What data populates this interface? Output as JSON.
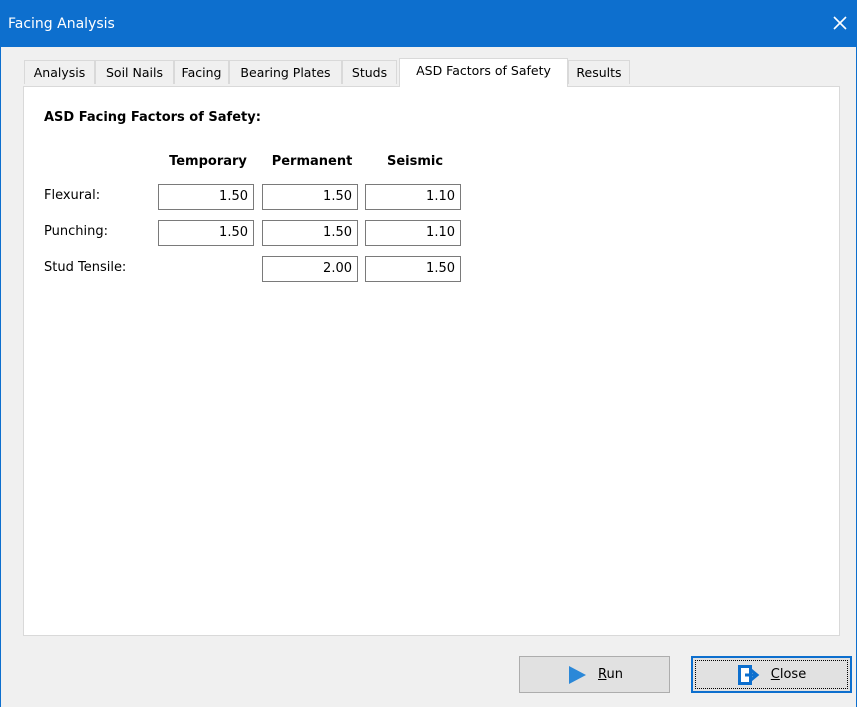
{
  "window": {
    "title": "Facing Analysis"
  },
  "tabs": [
    {
      "label": "Analysis"
    },
    {
      "label": "Soil Nails"
    },
    {
      "label": "Facing"
    },
    {
      "label": "Bearing Plates"
    },
    {
      "label": "Studs"
    },
    {
      "label": "ASD Factors of Safety",
      "active": true
    },
    {
      "label": "Results"
    }
  ],
  "section": {
    "title": "ASD Facing Factors of Safety:",
    "columns": [
      "Temporary",
      "Permanent",
      "Seismic"
    ],
    "rows": [
      {
        "label": "Flexural:",
        "temporary": "1.50",
        "permanent": "1.50",
        "seismic": "1.10"
      },
      {
        "label": "Punching:",
        "temporary": "1.50",
        "permanent": "1.50",
        "seismic": "1.10"
      },
      {
        "label": "Stud Tensile:",
        "temporary": "",
        "permanent": "2.00",
        "seismic": "1.50"
      }
    ]
  },
  "buttons": {
    "run": {
      "mnemonic": "R",
      "rest": "un",
      "icon": "play-icon",
      "color": "#2b88d8"
    },
    "close": {
      "mnemonic": "C",
      "rest": "lose",
      "icon": "exit-icon",
      "color": "#0d6fce"
    }
  },
  "colors": {
    "titlebar": "#0d6fce",
    "accent": "#2b88d8"
  }
}
